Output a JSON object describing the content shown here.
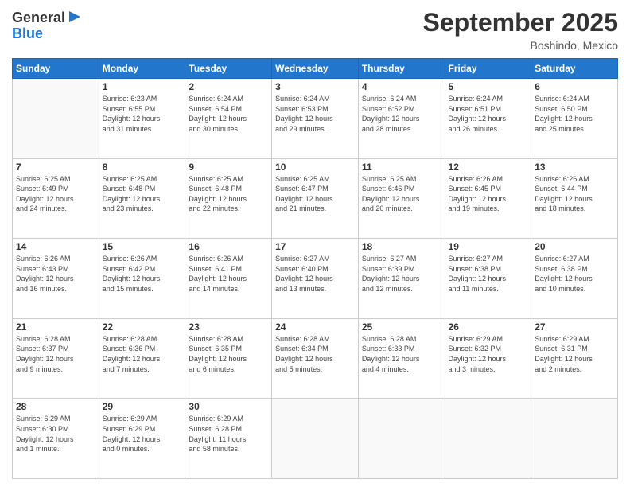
{
  "header": {
    "logo_line1": "General",
    "logo_line2": "Blue",
    "month": "September 2025",
    "location": "Boshindo, Mexico"
  },
  "weekdays": [
    "Sunday",
    "Monday",
    "Tuesday",
    "Wednesday",
    "Thursday",
    "Friday",
    "Saturday"
  ],
  "weeks": [
    [
      {
        "day": "",
        "info": ""
      },
      {
        "day": "1",
        "info": "Sunrise: 6:23 AM\nSunset: 6:55 PM\nDaylight: 12 hours\nand 31 minutes."
      },
      {
        "day": "2",
        "info": "Sunrise: 6:24 AM\nSunset: 6:54 PM\nDaylight: 12 hours\nand 30 minutes."
      },
      {
        "day": "3",
        "info": "Sunrise: 6:24 AM\nSunset: 6:53 PM\nDaylight: 12 hours\nand 29 minutes."
      },
      {
        "day": "4",
        "info": "Sunrise: 6:24 AM\nSunset: 6:52 PM\nDaylight: 12 hours\nand 28 minutes."
      },
      {
        "day": "5",
        "info": "Sunrise: 6:24 AM\nSunset: 6:51 PM\nDaylight: 12 hours\nand 26 minutes."
      },
      {
        "day": "6",
        "info": "Sunrise: 6:24 AM\nSunset: 6:50 PM\nDaylight: 12 hours\nand 25 minutes."
      }
    ],
    [
      {
        "day": "7",
        "info": "Sunrise: 6:25 AM\nSunset: 6:49 PM\nDaylight: 12 hours\nand 24 minutes."
      },
      {
        "day": "8",
        "info": "Sunrise: 6:25 AM\nSunset: 6:48 PM\nDaylight: 12 hours\nand 23 minutes."
      },
      {
        "day": "9",
        "info": "Sunrise: 6:25 AM\nSunset: 6:48 PM\nDaylight: 12 hours\nand 22 minutes."
      },
      {
        "day": "10",
        "info": "Sunrise: 6:25 AM\nSunset: 6:47 PM\nDaylight: 12 hours\nand 21 minutes."
      },
      {
        "day": "11",
        "info": "Sunrise: 6:25 AM\nSunset: 6:46 PM\nDaylight: 12 hours\nand 20 minutes."
      },
      {
        "day": "12",
        "info": "Sunrise: 6:26 AM\nSunset: 6:45 PM\nDaylight: 12 hours\nand 19 minutes."
      },
      {
        "day": "13",
        "info": "Sunrise: 6:26 AM\nSunset: 6:44 PM\nDaylight: 12 hours\nand 18 minutes."
      }
    ],
    [
      {
        "day": "14",
        "info": "Sunrise: 6:26 AM\nSunset: 6:43 PM\nDaylight: 12 hours\nand 16 minutes."
      },
      {
        "day": "15",
        "info": "Sunrise: 6:26 AM\nSunset: 6:42 PM\nDaylight: 12 hours\nand 15 minutes."
      },
      {
        "day": "16",
        "info": "Sunrise: 6:26 AM\nSunset: 6:41 PM\nDaylight: 12 hours\nand 14 minutes."
      },
      {
        "day": "17",
        "info": "Sunrise: 6:27 AM\nSunset: 6:40 PM\nDaylight: 12 hours\nand 13 minutes."
      },
      {
        "day": "18",
        "info": "Sunrise: 6:27 AM\nSunset: 6:39 PM\nDaylight: 12 hours\nand 12 minutes."
      },
      {
        "day": "19",
        "info": "Sunrise: 6:27 AM\nSunset: 6:38 PM\nDaylight: 12 hours\nand 11 minutes."
      },
      {
        "day": "20",
        "info": "Sunrise: 6:27 AM\nSunset: 6:38 PM\nDaylight: 12 hours\nand 10 minutes."
      }
    ],
    [
      {
        "day": "21",
        "info": "Sunrise: 6:28 AM\nSunset: 6:37 PM\nDaylight: 12 hours\nand 9 minutes."
      },
      {
        "day": "22",
        "info": "Sunrise: 6:28 AM\nSunset: 6:36 PM\nDaylight: 12 hours\nand 7 minutes."
      },
      {
        "day": "23",
        "info": "Sunrise: 6:28 AM\nSunset: 6:35 PM\nDaylight: 12 hours\nand 6 minutes."
      },
      {
        "day": "24",
        "info": "Sunrise: 6:28 AM\nSunset: 6:34 PM\nDaylight: 12 hours\nand 5 minutes."
      },
      {
        "day": "25",
        "info": "Sunrise: 6:28 AM\nSunset: 6:33 PM\nDaylight: 12 hours\nand 4 minutes."
      },
      {
        "day": "26",
        "info": "Sunrise: 6:29 AM\nSunset: 6:32 PM\nDaylight: 12 hours\nand 3 minutes."
      },
      {
        "day": "27",
        "info": "Sunrise: 6:29 AM\nSunset: 6:31 PM\nDaylight: 12 hours\nand 2 minutes."
      }
    ],
    [
      {
        "day": "28",
        "info": "Sunrise: 6:29 AM\nSunset: 6:30 PM\nDaylight: 12 hours\nand 1 minute."
      },
      {
        "day": "29",
        "info": "Sunrise: 6:29 AM\nSunset: 6:29 PM\nDaylight: 12 hours\nand 0 minutes."
      },
      {
        "day": "30",
        "info": "Sunrise: 6:29 AM\nSunset: 6:28 PM\nDaylight: 11 hours\nand 58 minutes."
      },
      {
        "day": "",
        "info": ""
      },
      {
        "day": "",
        "info": ""
      },
      {
        "day": "",
        "info": ""
      },
      {
        "day": "",
        "info": ""
      }
    ]
  ]
}
